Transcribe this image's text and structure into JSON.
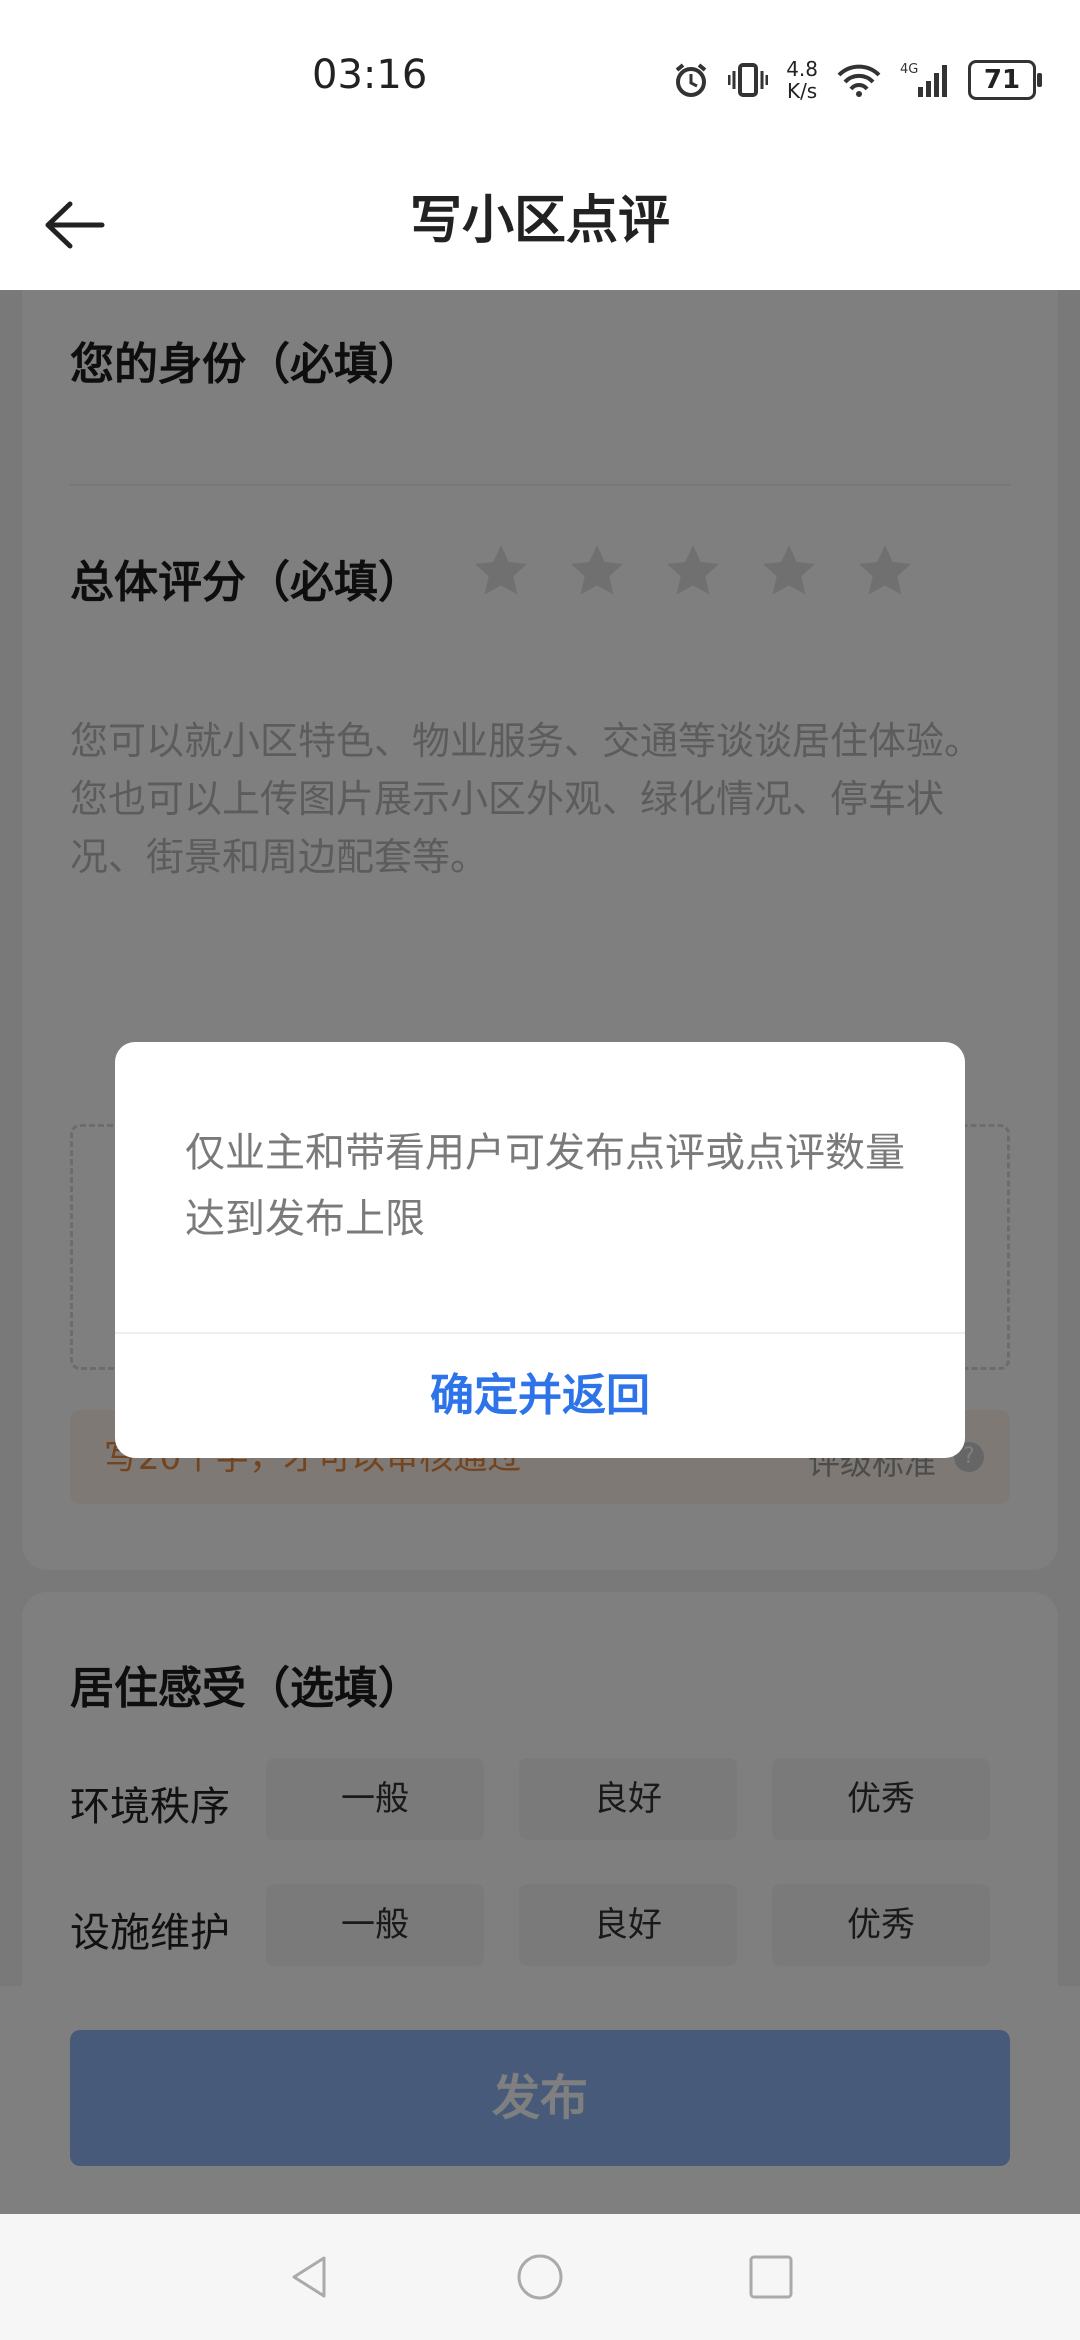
{
  "status_bar": {
    "time": "03:16",
    "net_speed_value": "4.8",
    "net_speed_unit": "K/s",
    "battery": "71"
  },
  "header": {
    "title": "写小区点评"
  },
  "form": {
    "identity_label": "您的身份（必填）",
    "rating_label": "总体评分（必填）",
    "placeholder_line1": "您可以就小区特色、物业服务、交通等谈谈居住体验。",
    "placeholder_line2": "您也可以上传图片展示小区外观、绿化情况、停车状况、街景和周边配套等。",
    "tip_left": "写20个字，才可以审核通过",
    "tip_right": "评级标准",
    "feeling_title": "居住感受（选填）",
    "rows": [
      {
        "label": "环境秩序",
        "options": [
          "一般",
          "良好",
          "优秀"
        ]
      },
      {
        "label": "设施维护",
        "options": [
          "一般",
          "良好",
          "优秀"
        ]
      }
    ],
    "publish_label": "发布"
  },
  "dialog": {
    "message": "仅业主和带看用户可发布点评或点评数量达到发布上限",
    "confirm_label": "确定并返回"
  },
  "colors": {
    "accent": "#2d74ea",
    "publish": "#8fb4f5",
    "tip": "#e8893c"
  }
}
